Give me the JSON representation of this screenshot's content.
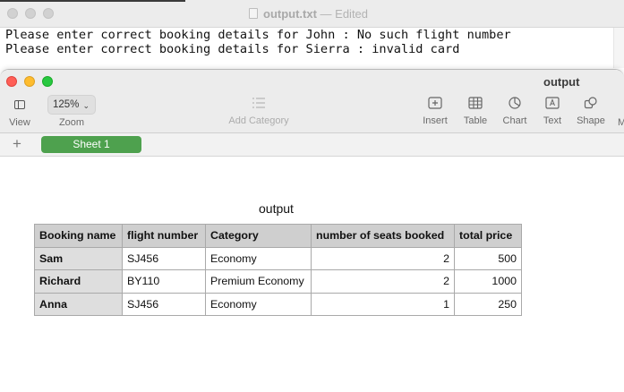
{
  "textedit": {
    "title": "output.txt",
    "status": "— Edited",
    "lines": [
      "Please enter correct booking details for John : No such flight number",
      "Please enter correct booking details for Sierra : invalid card"
    ]
  },
  "numbers": {
    "window_title": "output",
    "toolbar": {
      "view": "View",
      "zoom": "Zoom",
      "zoom_value": "125%",
      "add_category": "Add Category",
      "insert": "Insert",
      "table": "Table",
      "chart": "Chart",
      "text": "Text",
      "shape": "Shape",
      "media_partial": "M"
    },
    "add_sheet": "+",
    "sheets": [
      "Sheet 1"
    ],
    "table": {
      "title": "output",
      "headers": [
        "Booking name",
        "flight number",
        "Category",
        "number of seats booked",
        "total price"
      ],
      "rows": [
        [
          "Sam",
          "SJ456",
          "Economy",
          "2",
          "500"
        ],
        [
          "Richard",
          "BY110",
          "Premium Economy",
          "2",
          "1000"
        ],
        [
          "Anna",
          "SJ456",
          "Economy",
          "1",
          "250"
        ]
      ]
    }
  },
  "colors": {
    "sheet_tab": "#4ea14e",
    "close": "#ff5f57",
    "minimize": "#febc2e",
    "zoom": "#28c840"
  }
}
